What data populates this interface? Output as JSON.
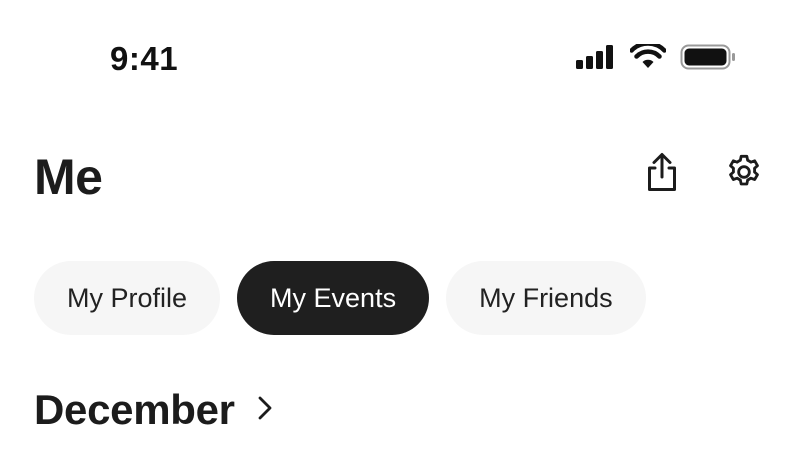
{
  "status_bar": {
    "time": "9:41",
    "icons": [
      "cellular-signal-icon",
      "wifi-icon",
      "battery-icon"
    ]
  },
  "header": {
    "title": "Me",
    "actions": [
      "share-icon",
      "gear-icon"
    ]
  },
  "tabs": [
    {
      "label": "My Profile",
      "active": false
    },
    {
      "label": "My Events",
      "active": true
    },
    {
      "label": "My Friends",
      "active": false
    }
  ],
  "section": {
    "title": "December",
    "icon": "chevron-right-icon"
  },
  "colors": {
    "active_tab_bg": "#1f1f1f",
    "inactive_tab_bg": "#f6f6f6",
    "text": "#1c1c1c"
  }
}
